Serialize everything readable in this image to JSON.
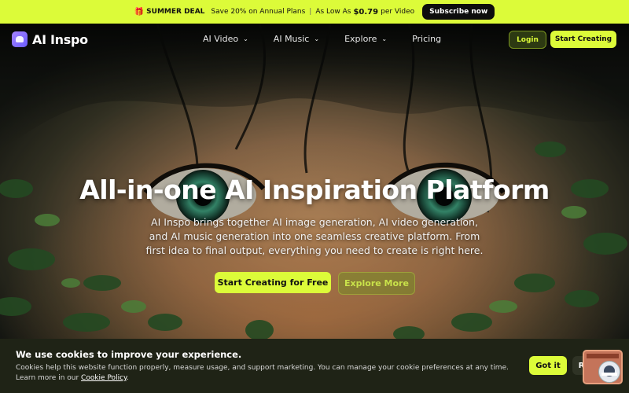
{
  "promo": {
    "icon": "gift-icon",
    "deal": "SUMMER DEAL",
    "offer": "Save 20% on Annual Plans",
    "as_low_as": "As Low As",
    "price": "$0.79",
    "per": "per Video",
    "subscribe_label": "Subscribe now"
  },
  "nav": {
    "brand": "AI Inspo",
    "items": [
      {
        "label": "AI Video",
        "dropdown": true
      },
      {
        "label": "AI Music",
        "dropdown": true
      },
      {
        "label": "Explore",
        "dropdown": true
      },
      {
        "label": "Pricing",
        "dropdown": false
      }
    ],
    "login_label": "Login",
    "start_label": "Start Creating"
  },
  "hero": {
    "title": "All-in-one AI Inspiration Platform",
    "subtitle": "AI Inspo brings together AI image generation, AI video generation, and AI music generation into one seamless creative platform. From first idea to final output, everything you need to create is right here.",
    "primary_cta": "Start Creating for Free",
    "secondary_cta": "Explore More"
  },
  "cookie": {
    "title": "We use cookies to improve your experience.",
    "body": "Cookies help this website function properly, measure usage, and support marketing. You can manage your cookie preferences at any time. Learn more in our",
    "policy_link": "Cookie Policy",
    "period": ".",
    "accept_label": "Got it",
    "reject_label": "Reje"
  },
  "colors": {
    "accent": "#dcfb39",
    "banner_bg": "#1f2316"
  }
}
